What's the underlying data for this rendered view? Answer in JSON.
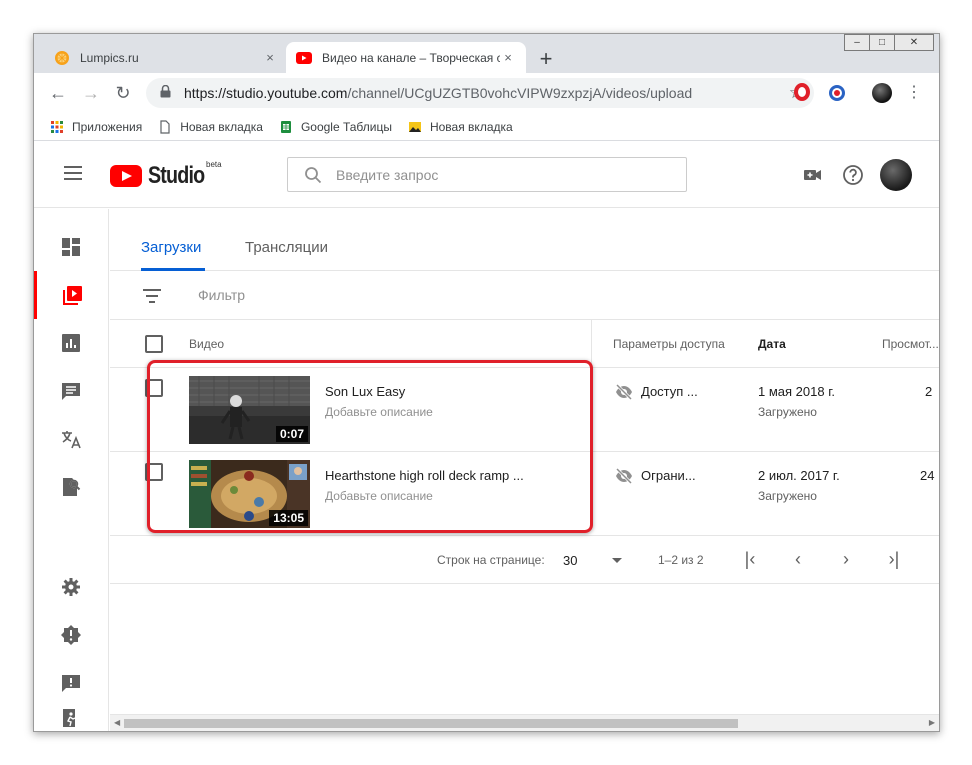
{
  "browser": {
    "tabs": [
      {
        "title": "Lumpics.ru",
        "icon": "orange-favicon",
        "close": "×"
      },
      {
        "title": "Видео на канале – Творческая с",
        "icon": "youtube-favicon",
        "close": "×"
      }
    ],
    "new_tab": "+",
    "window_controls": {
      "minimize": "–",
      "maximize": "□",
      "close": "✕"
    },
    "url": {
      "scheme": "https://",
      "host": "studio.youtube.com",
      "path": "/channel/UCgUZGTB0vohcVIPW9zxpzjA/videos/upload"
    },
    "bookmarks": [
      {
        "label": "Приложения",
        "icon": "apps-grid-icon"
      },
      {
        "label": "Новая вкладка",
        "icon": "page-icon"
      },
      {
        "label": "Google Таблицы",
        "icon": "sheets-icon"
      },
      {
        "label": "Новая вкладка",
        "icon": "image-icon"
      }
    ]
  },
  "studio": {
    "logo_text": "Studio",
    "logo_badge": "beta",
    "search_placeholder": "Введите запрос",
    "tabs": [
      "Загрузки",
      "Трансляции"
    ],
    "filter_label": "Фильтр",
    "columns": {
      "video": "Видео",
      "visibility": "Параметры доступа",
      "date": "Дата",
      "views": "Просмот..."
    },
    "videos": [
      {
        "title": "Son Lux Easy",
        "description": "Добавьте описание",
        "duration": "0:07",
        "visibility": "Доступ ...",
        "date": "1 мая 2018 г.",
        "status": "Загружено",
        "views": "2"
      },
      {
        "title": "Hearthstone high roll deck ramp ...",
        "description": "Добавьте описание",
        "duration": "13:05",
        "visibility": "Ограни...",
        "date": "2 июл. 2017 г.",
        "status": "Загружено",
        "views": "24"
      }
    ],
    "pagination": {
      "rows_label": "Строк на странице:",
      "rows_value": "30",
      "range": "1–2 из 2"
    }
  },
  "colors": {
    "accent_blue": "#065fd4",
    "youtube_red": "#ff0000",
    "highlight_red": "#e0202a"
  }
}
